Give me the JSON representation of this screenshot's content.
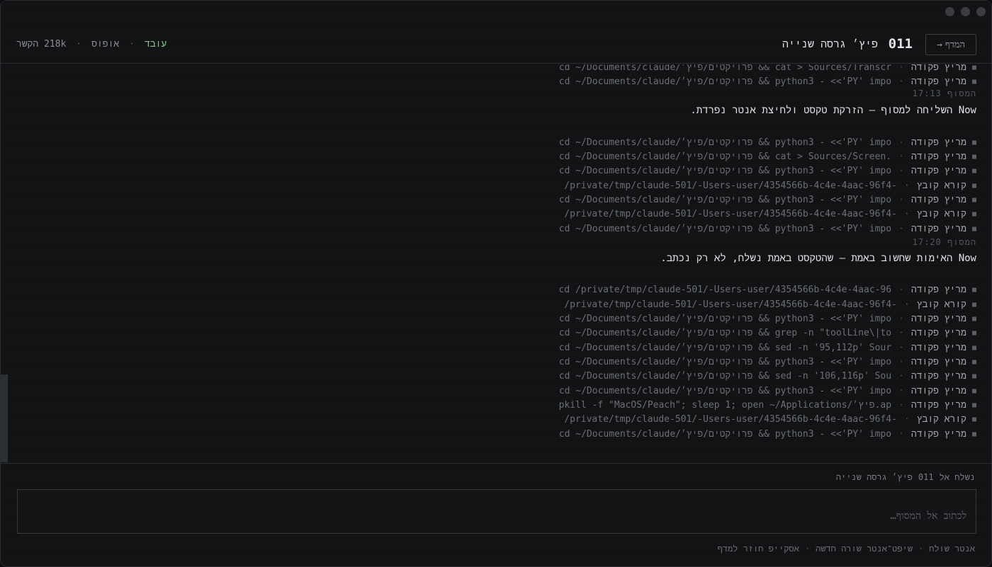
{
  "header": {
    "back_label": "המדף",
    "back_icon": "arrow-right-icon",
    "session_number": "011",
    "session_title": "פיץ׳ גרסה שנייה",
    "status_working": "עובד",
    "status_sep": "·",
    "model": "אופוס",
    "context": "218k הקשר",
    "accent_working": "#88c98a"
  },
  "log": {
    "items": [
      {
        "kind": "מריץ פקודה",
        "cmd": "cd ~/Documents/claude/פרויקטים/פיץ׳ && cat > Sources/Transcr"
      },
      {
        "kind": "מריץ פקודה",
        "cmd": "cd ~/Documents/claude/פרויקטים/פיץ׳ && python3 - <<'PY' impo"
      },
      {
        "kind": "מריץ פקודה",
        "cmd": "cd ~/Documents/claude/פרויקטים/פיץ׳ && python3 - <<'PY' impo"
      },
      {
        "kind": "מריץ פקודה",
        "cmd": "cd ~/Documents/claude/פרויקטים/פיץ׳ && cat > Sources/Screen."
      },
      {
        "kind": "מריץ פקודה",
        "cmd": "cd ~/Documents/claude/פרויקטים/פיץ׳ && python3 - <<'PY' impo"
      },
      {
        "kind": "קורא קובץ",
        "cmd": "/private/tmp/claude-501/-Users-user/4354566b-4c4e-4aac-96f4-"
      },
      {
        "kind": "מריץ פקודה",
        "cmd": "cd ~/Documents/claude/פרויקטים/פיץ׳ && python3 - <<'PY' impo"
      },
      {
        "kind": "קורא קובץ",
        "cmd": "/private/tmp/claude-501/-Users-user/4354566b-4c4e-4aac-96f4-"
      },
      {
        "kind": "מריץ פקודה",
        "cmd": "cd ~/Documents/claude/פרויקטים/פיץ׳ && python3 - <<'PY' impo"
      },
      {
        "kind": "מריץ פקודה",
        "cmd": "cd /private/tmp/claude-501/-Users-user/4354566b-4c4e-4aac-96"
      },
      {
        "kind": "קורא קובץ",
        "cmd": "/private/tmp/claude-501/-Users-user/4354566b-4c4e-4aac-96f4-"
      },
      {
        "kind": "מריץ פקודה",
        "cmd": "cd ~/Documents/claude/פרויקטים/פיץ׳ && python3 - <<'PY' impo"
      },
      {
        "kind": "מריץ פקודה",
        "cmd": "cd ~/Documents/claude/פרויקטים/פיץ׳ && grep -n \"toolLine\\|to"
      },
      {
        "kind": "מריץ פקודה",
        "cmd": "cd ~/Documents/claude/פרויקטים/פיץ׳ && sed -n '95,112p' Sour"
      },
      {
        "kind": "מריץ פקודה",
        "cmd": "cd ~/Documents/claude/פרויקטים/פיץ׳ && python3 - <<'PY' impo"
      },
      {
        "kind": "מריץ פקודה",
        "cmd": "cd ~/Documents/claude/פרויקטים/פיץ׳ && sed -n '106,116p' Sou"
      },
      {
        "kind": "מריץ פקודה",
        "cmd": "cd ~/Documents/claude/פרויקטים/פיץ׳ && python3 - <<'PY' impo"
      },
      {
        "kind": "מריץ פקודה",
        "cmd": "pkill -f \"MacOS/Peach\"; sleep 1; open ~/Applications/פיץ׳.ap"
      },
      {
        "kind": "קורא קובץ",
        "cmd": "/private/tmp/claude-501/-Users-user/4354566b-4c4e-4aac-96f4-"
      },
      {
        "kind": "מריץ פקודה",
        "cmd": "cd ~/Documents/claude/פרויקטים/פיץ׳ && python3 - <<'PY' impo"
      }
    ],
    "timestamps": [
      "המסוף 17:13",
      "המסוף 17:20"
    ],
    "messages": [
      "Now השליחה למסוף — הזרקת טקסט ולחיצת אנטר נפרדת.",
      "Now האימות שחשוב באמת — שהטקסט באמת נשלח, לא רק נכתב."
    ]
  },
  "composer": {
    "send_to_label": "נשלח אל",
    "send_to_number": "011",
    "send_to_title": "פיץ׳ גרסה שנייה",
    "placeholder": "לכתוב אל המסוף…",
    "value": ""
  },
  "hints": {
    "send": "אנטר שולח",
    "newline": "שיפט־אנטר שורה חדשה",
    "back": "אסקייפ חוזר למדף",
    "sep": "·"
  }
}
